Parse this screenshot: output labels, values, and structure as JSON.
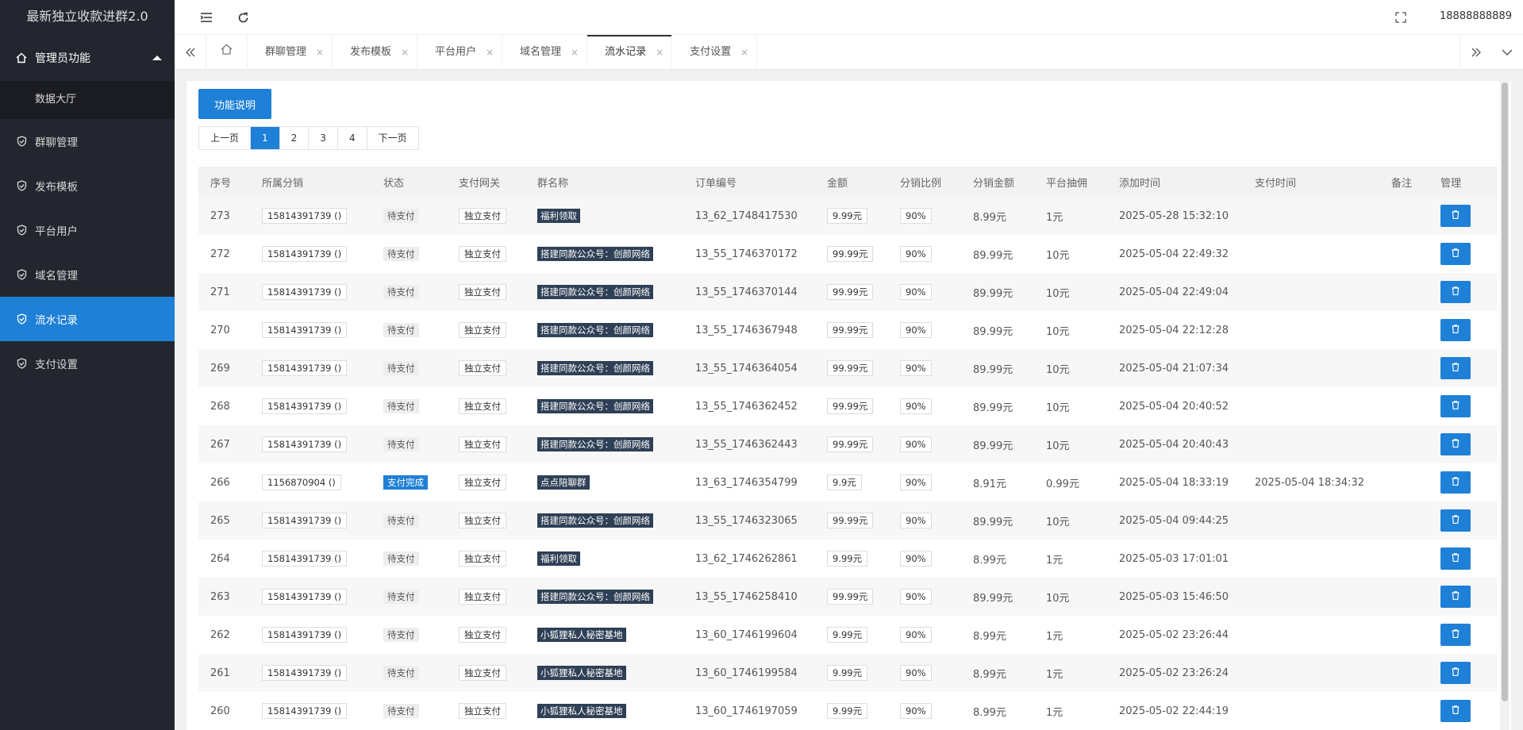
{
  "app": {
    "title": "最新独立收款进群2.0",
    "user": "18888888889"
  },
  "sidebar": {
    "group_label": "管理员功能",
    "sub_item": "数据大厅",
    "items": [
      {
        "label": "群聊管理",
        "active": false
      },
      {
        "label": "发布模板",
        "active": false
      },
      {
        "label": "平台用户",
        "active": false
      },
      {
        "label": "域名管理",
        "active": false
      },
      {
        "label": "流水记录",
        "active": true
      },
      {
        "label": "支付设置",
        "active": false
      }
    ]
  },
  "tabs": [
    {
      "label": "群聊管理",
      "close": "×"
    },
    {
      "label": "发布模板",
      "close": "×"
    },
    {
      "label": "平台用户",
      "close": "×"
    },
    {
      "label": "域名管理",
      "close": "×"
    },
    {
      "label": "流水记录",
      "close": "×"
    },
    {
      "label": "支付设置",
      "close": "×"
    }
  ],
  "toolbar": {
    "help_button": "功能说明"
  },
  "pager": {
    "prev": "上一页",
    "pages": [
      "1",
      "2",
      "3",
      "4"
    ],
    "next": "下一页",
    "current": "1"
  },
  "table": {
    "headers": [
      "序号",
      "所属分销",
      "状态",
      "支付网关",
      "群名称",
      "订单编号",
      "金额",
      "分销比例",
      "分销金额",
      "平台抽佣",
      "添加时间",
      "支付时间",
      "备注",
      "管理"
    ],
    "rows": [
      {
        "id": "273",
        "dist": "15814391739 ()",
        "status": "待支付",
        "gateway": "独立支付",
        "group": "福利领取",
        "order": "13_62_1748417530",
        "amount": "9.99元",
        "ratio": "90%",
        "dist_amount": "8.99元",
        "fee": "1元",
        "added": "2025-05-28 15:32:10",
        "paid": "",
        "note": ""
      },
      {
        "id": "272",
        "dist": "15814391739 ()",
        "status": "待支付",
        "gateway": "独立支付",
        "group": "搭建同款公众号：创颜网络",
        "order": "13_55_1746370172",
        "amount": "99.99元",
        "ratio": "90%",
        "dist_amount": "89.99元",
        "fee": "10元",
        "added": "2025-05-04 22:49:32",
        "paid": "",
        "note": ""
      },
      {
        "id": "271",
        "dist": "15814391739 ()",
        "status": "待支付",
        "gateway": "独立支付",
        "group": "搭建同款公众号：创颜网络",
        "order": "13_55_1746370144",
        "amount": "99.99元",
        "ratio": "90%",
        "dist_amount": "89.99元",
        "fee": "10元",
        "added": "2025-05-04 22:49:04",
        "paid": "",
        "note": ""
      },
      {
        "id": "270",
        "dist": "15814391739 ()",
        "status": "待支付",
        "gateway": "独立支付",
        "group": "搭建同款公众号：创颜网络",
        "order": "13_55_1746367948",
        "amount": "99.99元",
        "ratio": "90%",
        "dist_amount": "89.99元",
        "fee": "10元",
        "added": "2025-05-04 22:12:28",
        "paid": "",
        "note": ""
      },
      {
        "id": "269",
        "dist": "15814391739 ()",
        "status": "待支付",
        "gateway": "独立支付",
        "group": "搭建同款公众号：创颜网络",
        "order": "13_55_1746364054",
        "amount": "99.99元",
        "ratio": "90%",
        "dist_amount": "89.99元",
        "fee": "10元",
        "added": "2025-05-04 21:07:34",
        "paid": "",
        "note": ""
      },
      {
        "id": "268",
        "dist": "15814391739 ()",
        "status": "待支付",
        "gateway": "独立支付",
        "group": "搭建同款公众号：创颜网络",
        "order": "13_55_1746362452",
        "amount": "99.99元",
        "ratio": "90%",
        "dist_amount": "89.99元",
        "fee": "10元",
        "added": "2025-05-04 20:40:52",
        "paid": "",
        "note": ""
      },
      {
        "id": "267",
        "dist": "15814391739 ()",
        "status": "待支付",
        "gateway": "独立支付",
        "group": "搭建同款公众号：创颜网络",
        "order": "13_55_1746362443",
        "amount": "99.99元",
        "ratio": "90%",
        "dist_amount": "89.99元",
        "fee": "10元",
        "added": "2025-05-04 20:40:43",
        "paid": "",
        "note": ""
      },
      {
        "id": "266",
        "dist": "1156870904 ()",
        "status": "支付完成",
        "gateway": "独立支付",
        "group": "点点陪聊群",
        "order": "13_63_1746354799",
        "amount": "9.9元",
        "ratio": "90%",
        "dist_amount": "8.91元",
        "fee": "0.99元",
        "added": "2025-05-04 18:33:19",
        "paid": "2025-05-04 18:34:32",
        "note": ""
      },
      {
        "id": "265",
        "dist": "15814391739 ()",
        "status": "待支付",
        "gateway": "独立支付",
        "group": "搭建同款公众号：创颜网络",
        "order": "13_55_1746323065",
        "amount": "99.99元",
        "ratio": "90%",
        "dist_amount": "89.99元",
        "fee": "10元",
        "added": "2025-05-04 09:44:25",
        "paid": "",
        "note": ""
      },
      {
        "id": "264",
        "dist": "15814391739 ()",
        "status": "待支付",
        "gateway": "独立支付",
        "group": "福利领取",
        "order": "13_62_1746262861",
        "amount": "9.99元",
        "ratio": "90%",
        "dist_amount": "8.99元",
        "fee": "1元",
        "added": "2025-05-03 17:01:01",
        "paid": "",
        "note": ""
      },
      {
        "id": "263",
        "dist": "15814391739 ()",
        "status": "待支付",
        "gateway": "独立支付",
        "group": "搭建同款公众号：创颜网络",
        "order": "13_55_1746258410",
        "amount": "99.99元",
        "ratio": "90%",
        "dist_amount": "89.99元",
        "fee": "10元",
        "added": "2025-05-03 15:46:50",
        "paid": "",
        "note": ""
      },
      {
        "id": "262",
        "dist": "15814391739 ()",
        "status": "待支付",
        "gateway": "独立支付",
        "group": "小狐狸私人秘密基地",
        "order": "13_60_1746199604",
        "amount": "9.99元",
        "ratio": "90%",
        "dist_amount": "8.99元",
        "fee": "1元",
        "added": "2025-05-02 23:26:44",
        "paid": "",
        "note": ""
      },
      {
        "id": "261",
        "dist": "15814391739 ()",
        "status": "待支付",
        "gateway": "独立支付",
        "group": "小狐狸私人秘密基地",
        "order": "13_60_1746199584",
        "amount": "9.99元",
        "ratio": "90%",
        "dist_amount": "8.99元",
        "fee": "1元",
        "added": "2025-05-02 23:26:24",
        "paid": "",
        "note": ""
      },
      {
        "id": "260",
        "dist": "15814391739 ()",
        "status": "待支付",
        "gateway": "独立支付",
        "group": "小狐狸私人秘密基地",
        "order": "13_60_1746197059",
        "amount": "9.99元",
        "ratio": "90%",
        "dist_amount": "8.99元",
        "fee": "1元",
        "added": "2025-05-02 22:44:19",
        "paid": "",
        "note": ""
      }
    ]
  },
  "colors": {
    "accent": "#1e80d6",
    "sidebar_bg": "#23262e",
    "group_tag": "#2f4056"
  }
}
